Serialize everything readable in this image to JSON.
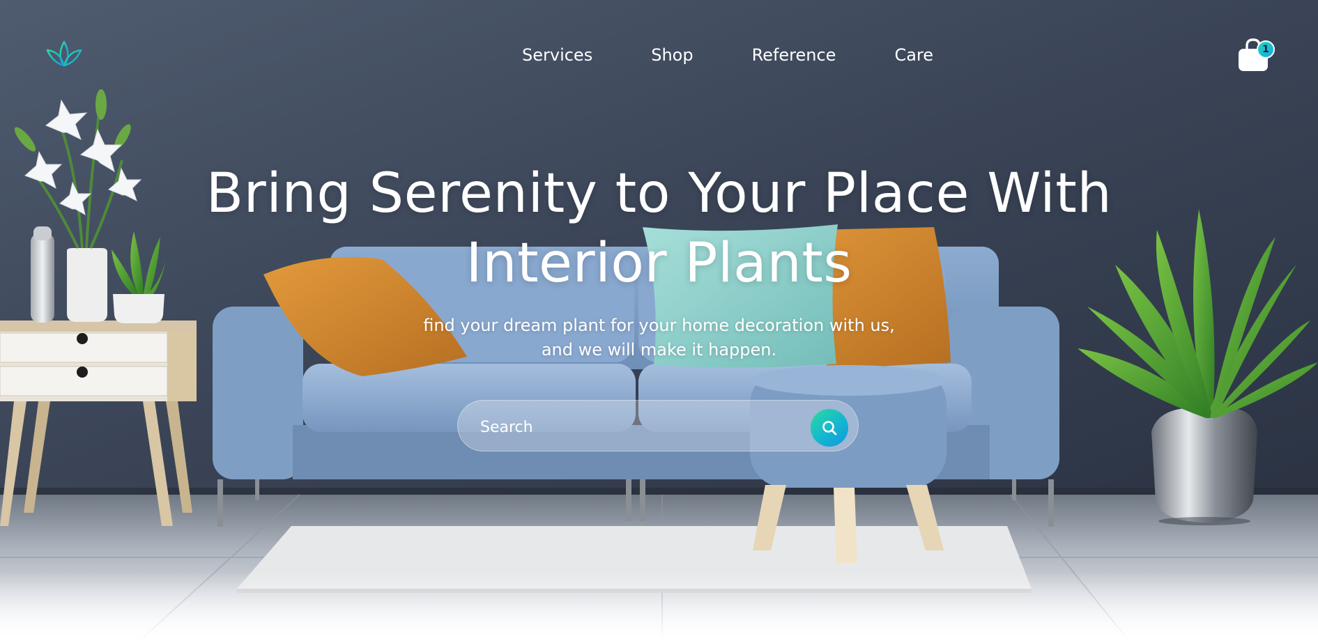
{
  "nav": {
    "links": [
      {
        "label": "Services"
      },
      {
        "label": "Shop"
      },
      {
        "label": "Reference"
      },
      {
        "label": "Care"
      }
    ],
    "cart_count": "1"
  },
  "hero": {
    "headline_line1": "Bring Serenity to Your Place With",
    "headline_line2": "Interior Plants",
    "subline_line1": "find your dream plant for your home decoration with us,",
    "subline_line2": "and we will make it happen."
  },
  "search": {
    "placeholder": "Search",
    "value": ""
  },
  "colors": {
    "wall": "#3c4759",
    "accent_start": "#2bdc9f",
    "accent_end": "#1296e2",
    "sofa": "#7f9ec4",
    "pillow_orange": "#d48a32",
    "pillow_teal": "#8fd0cc",
    "floor": "#c9ced6"
  },
  "icons": {
    "logo": "lotus-leaf-icon",
    "cart": "shopping-bag-icon",
    "search": "search-icon"
  }
}
